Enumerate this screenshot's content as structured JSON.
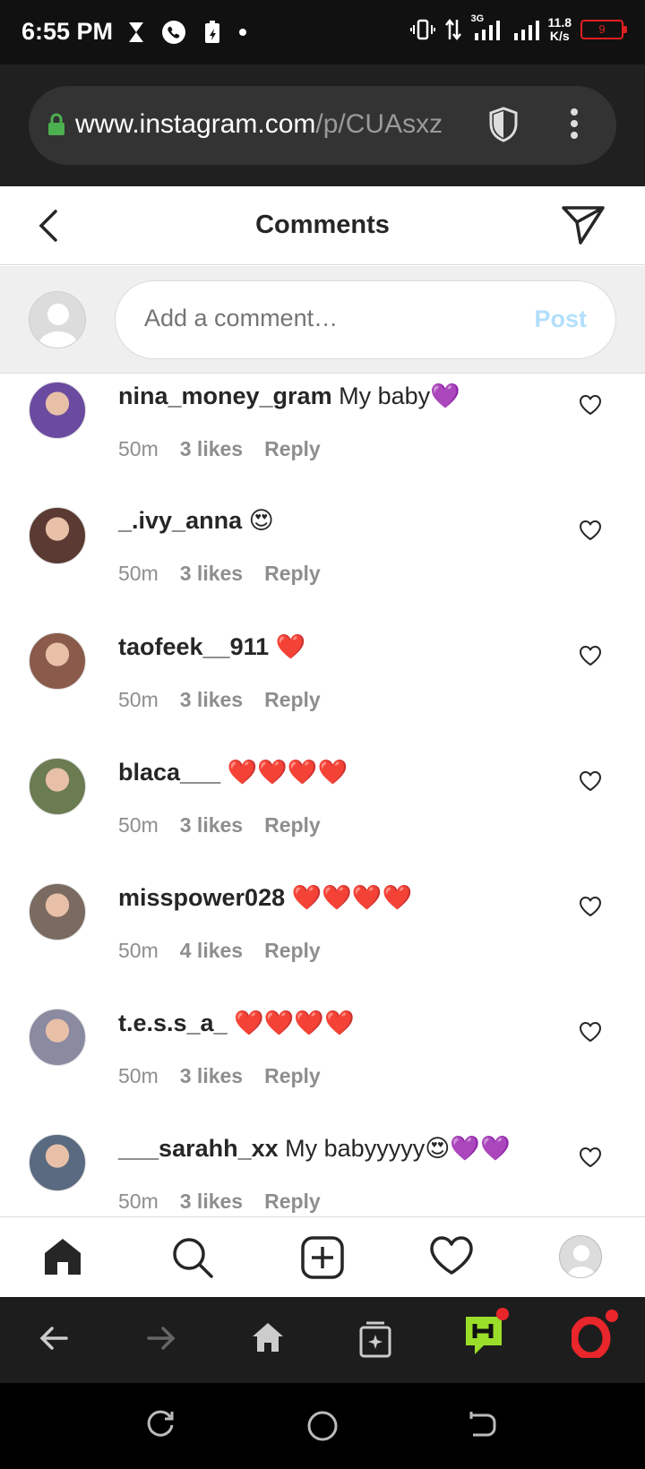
{
  "status_bar": {
    "time": "6:55 PM",
    "network": "3G",
    "speed_value": "11.8",
    "speed_unit": "K/s",
    "battery": "9",
    "icons": [
      "hourglass-icon",
      "phone-icon",
      "battery-saver-icon",
      "dot-icon",
      "vibrate-icon",
      "data-arrows-icon",
      "signal-icon",
      "signal-icon-2"
    ]
  },
  "browser": {
    "url_main": "www.instagram.com",
    "url_rest": "/p/CUAsxz",
    "icons": [
      "lock-icon",
      "shield-icon",
      "more-vert-icon"
    ]
  },
  "header": {
    "title": "Comments",
    "icons": [
      "back-arrow-icon",
      "send-icon"
    ]
  },
  "composer": {
    "placeholder": "Add a comment…",
    "post_label": "Post"
  },
  "comments": [
    {
      "username": "nina_money_gram",
      "text": "My baby💜",
      "time": "50m",
      "likes": "3 likes",
      "reply": "Reply",
      "avatar_color": "#6a4ba0"
    },
    {
      "username": "_.ivy_anna",
      "text": "😍",
      "time": "50m",
      "likes": "3 likes",
      "reply": "Reply",
      "avatar_color": "#5a3a32"
    },
    {
      "username": "taofeek__911",
      "text": "❤️",
      "time": "50m",
      "likes": "3 likes",
      "reply": "Reply",
      "avatar_color": "#8a5a4a"
    },
    {
      "username": "blaca___",
      "text": "❤️❤️❤️❤️",
      "time": "50m",
      "likes": "3 likes",
      "reply": "Reply",
      "avatar_color": "#6b7b52"
    },
    {
      "username": "misspower028",
      "text": "❤️❤️❤️❤️",
      "time": "50m",
      "likes": "4 likes",
      "reply": "Reply",
      "avatar_color": "#7a6a60"
    },
    {
      "username": "t.e.s.s_a_",
      "text": "❤️❤️❤️❤️",
      "time": "50m",
      "likes": "3 likes",
      "reply": "Reply",
      "avatar_color": "#8a8aa0"
    },
    {
      "username": "___sarahh_xx",
      "text": "My babyyyyy😍💜💜",
      "time": "50m",
      "likes": "3 likes",
      "reply": "Reply",
      "avatar_color": "#5a6a80"
    }
  ],
  "ig_nav": {
    "icons": [
      "home-icon",
      "search-icon",
      "new-post-icon",
      "activity-heart-icon",
      "profile-avatar-icon"
    ]
  },
  "browser_nav": {
    "icons": [
      "browser-back-icon",
      "browser-forward-icon",
      "browser-home-icon",
      "tabs-icon",
      "games-hub-icon",
      "opera-icon"
    ]
  },
  "android_nav": {
    "icons": [
      "recents-icon",
      "home-circle-icon",
      "system-back-icon"
    ]
  },
  "colors": {
    "status_bar": "#111111",
    "url_bar": "#202020",
    "accent_post": "#b2dffc",
    "text_primary": "#262626",
    "text_secondary": "#8e8e8e",
    "notification_dot": "#e8262b"
  }
}
